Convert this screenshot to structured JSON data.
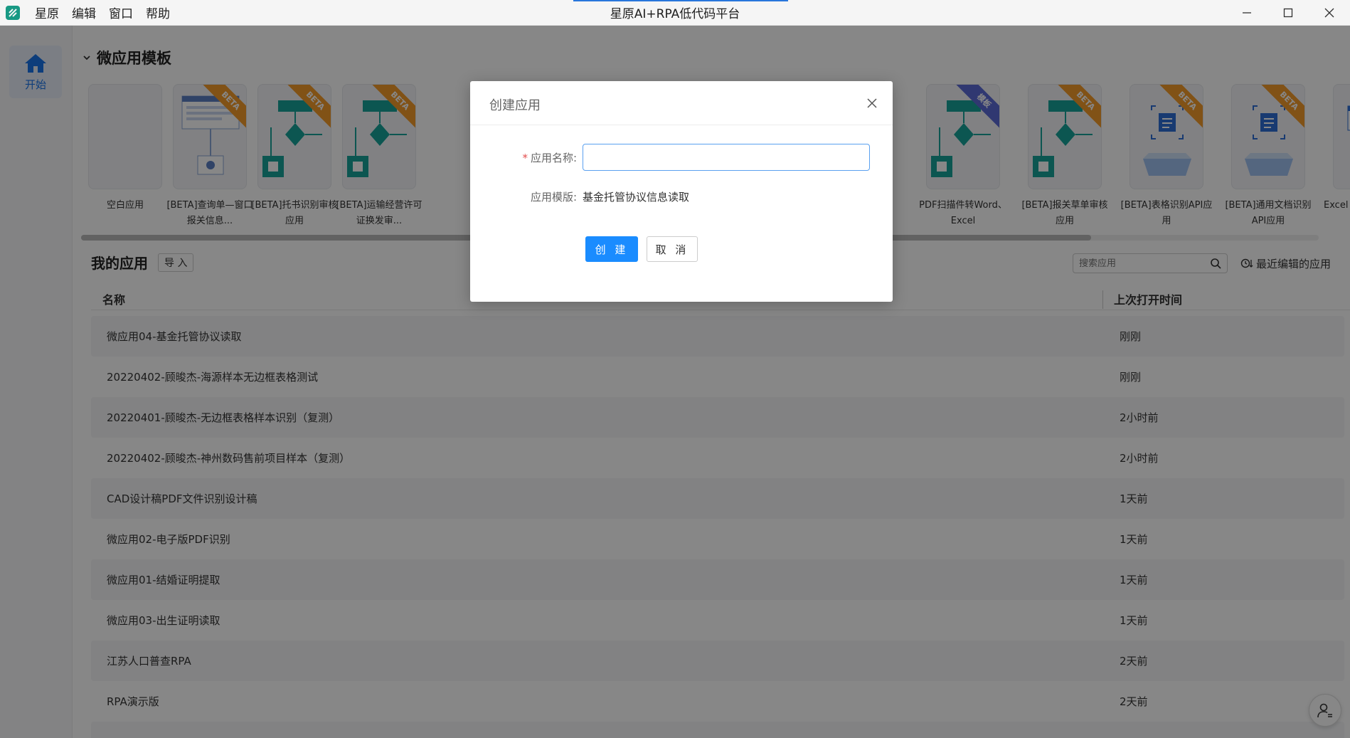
{
  "app": {
    "window_title": "星原AI+RPA低代码平台",
    "menu": [
      "星原",
      "编辑",
      "窗口",
      "帮助"
    ]
  },
  "nav": {
    "home_label": "开始"
  },
  "templates": {
    "section_title": "微应用模板",
    "items": [
      {
        "label": "空白应用",
        "badge": ""
      },
      {
        "label": "[BETA]查询单—窗口报关信息...",
        "badge": "BETA"
      },
      {
        "label": "[BETA]托书识别审核应用",
        "badge": "BETA"
      },
      {
        "label": "[BETA]运输经营许可证换发审...",
        "badge": "BETA"
      },
      {
        "label": "PDF扫描件转Word、Excel",
        "badge": "模板"
      },
      {
        "label": "[BETA]报关草单审核应用",
        "badge": "BETA"
      },
      {
        "label": "[BETA]表格识别API应用",
        "badge": "BETA"
      },
      {
        "label": "[BETA]通用文档识别API应用",
        "badge": "BETA"
      },
      {
        "label": "Excel",
        "badge": ""
      }
    ]
  },
  "my_apps": {
    "title": "我的应用",
    "import_label": "导 入",
    "search_placeholder": "搜索应用",
    "recent_label": "最近编辑的应用",
    "col_name": "名称",
    "col_time": "上次打开时间",
    "rows": [
      {
        "name": "微应用04-基金托管协议读取",
        "time": "刚刚"
      },
      {
        "name": "20220402-顾晙杰-海源样本无边框表格测试",
        "time": "刚刚"
      },
      {
        "name": "20220401-顾晙杰-无边框表格样本识别（复测）",
        "time": "2小时前"
      },
      {
        "name": "20220402-顾晙杰-神州数码售前项目样本（复测）",
        "time": "2小时前"
      },
      {
        "name": "CAD设计稿PDF文件识别设计稿",
        "time": "1天前"
      },
      {
        "name": "微应用02-电子版PDF识别",
        "time": "1天前"
      },
      {
        "name": "微应用01-结婚证明提取",
        "time": "1天前"
      },
      {
        "name": "微应用03-出生证明读取",
        "time": "1天前"
      },
      {
        "name": "江苏人口普查RPA",
        "time": "2天前"
      },
      {
        "name": "RPA演示版",
        "time": "2天前"
      }
    ]
  },
  "dialog": {
    "title": "创建应用",
    "name_label": "应用名称:",
    "name_value": "",
    "template_label": "应用模版:",
    "template_value": "基金托管协议信息读取",
    "create_label": "创 建",
    "cancel_label": "取 消"
  },
  "colors": {
    "primary": "#1a8cff",
    "badge_beta": "#f39c2b",
    "badge_template": "#5b6bd6",
    "teal": "#18a39a"
  }
}
